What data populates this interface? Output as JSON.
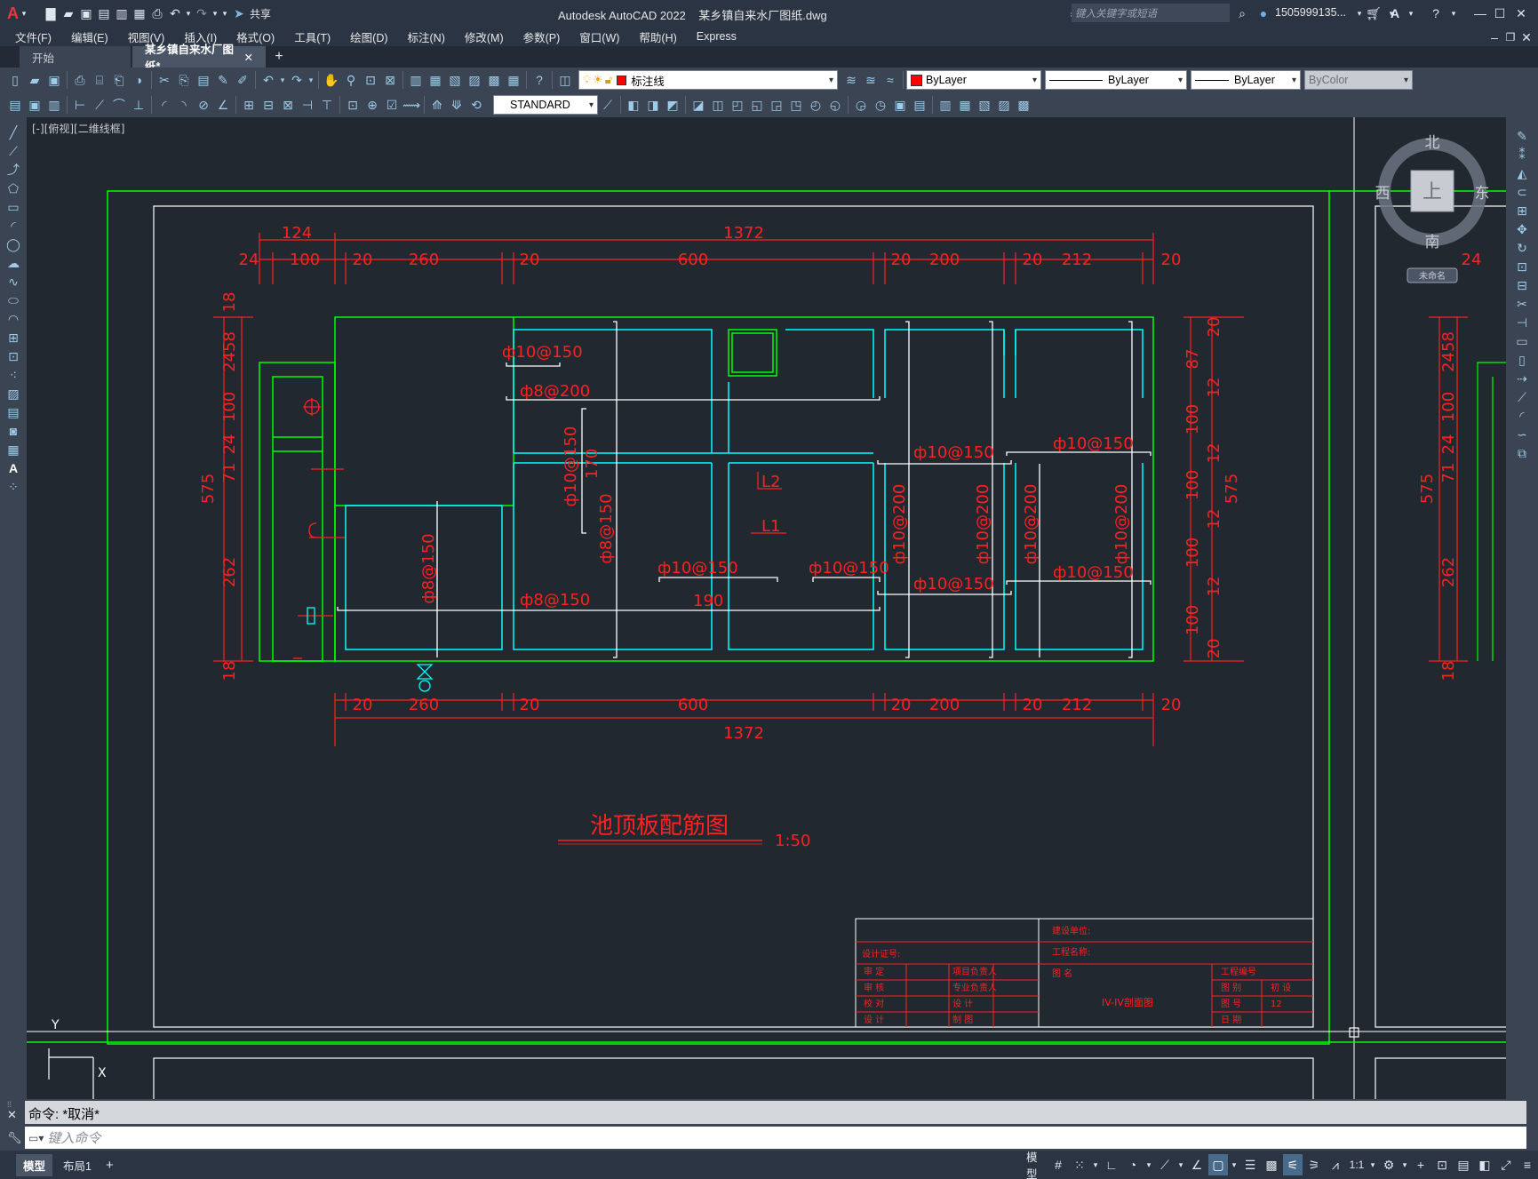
{
  "title": {
    "app_title": "Autodesk AutoCAD 2022",
    "file_title": "某乡镇自来水厂图纸.dwg",
    "share_label": "共享",
    "search_placeholder": "键入关键字或短语",
    "user_name": "1505999135..."
  },
  "menus": [
    "文件(F)",
    "编辑(E)",
    "视图(V)",
    "插入(I)",
    "格式(O)",
    "工具(T)",
    "绘图(D)",
    "标注(N)",
    "修改(M)",
    "参数(P)",
    "窗口(W)",
    "帮助(H)",
    "Express"
  ],
  "tabs": {
    "start": "开始",
    "drawing": "某乡镇自来水厂图纸*"
  },
  "toolbar": {
    "layer_name": "标注线",
    "color": "ByLayer",
    "linetype": "ByLayer",
    "lineweight": "ByLayer",
    "plotstyle": "ByColor",
    "dimstyle": "STANDARD"
  },
  "viewport_label": "[-][俯视][二维线框]",
  "viewcube": {
    "top": "上",
    "north": "北",
    "south": "南",
    "west": "西",
    "east": "东",
    "wcs": "未命名"
  },
  "drawing": {
    "title": "池顶板配筋图",
    "scale": "1:50",
    "top_dims_row1": [
      "124",
      "1372"
    ],
    "top_dims_row2": [
      "24",
      "100",
      "20",
      "260",
      "20",
      "600",
      "20",
      "200",
      "20",
      "212",
      "20"
    ],
    "bottom_dims": [
      "20",
      "260",
      "20",
      "600",
      "20",
      "200",
      "20",
      "212",
      "20"
    ],
    "bottom_total": "1372",
    "left_dims": [
      "18",
      "2458",
      "100",
      "24",
      "71",
      "262",
      "18"
    ],
    "left_total": "575",
    "right_dims": [
      "20",
      "87",
      "12",
      "100",
      "12",
      "100",
      "12",
      "100",
      "12",
      "100",
      "20"
    ],
    "right_total": "575",
    "rebar": {
      "r1": "ф10@150",
      "r2": "ф8@200",
      "r3": "ф10@150",
      "r4": "170",
      "r5": "ф8@150",
      "r6": "ф8@150",
      "r7": "ф8@150",
      "r8": "ф10@150",
      "r9": "190",
      "r10": "ф10@150",
      "r11": "ф10@150",
      "r12": "ф10@150",
      "r13": "ф10@150",
      "r14": "ф10@200",
      "r15": "ф10@200",
      "r16": "ф10@200",
      "r17": "ф10@200",
      "r18": "ф10@150",
      "l1": "L1",
      "l2": "L2"
    },
    "right_partial_dims": [
      "24",
      "2458",
      "100",
      "24",
      "71",
      "575",
      "262",
      "18"
    ]
  },
  "titleblock": {
    "build_unit": "建设单位:",
    "project_name": "工程名称:",
    "design_cert": "设计证号:",
    "drawing_name_label": "图  名",
    "drawing_name": "IV-IV剖面图",
    "rows_left": [
      "审  定",
      "审  核",
      "校  对",
      "设  计"
    ],
    "rows_mid": [
      "项目负责人",
      "专业负责人",
      "设  计",
      "制  图"
    ],
    "rows_right_label": [
      "工程编号",
      "图  别",
      "图  号",
      "日  期"
    ],
    "rows_right_value": [
      "",
      "初  设",
      "12",
      ""
    ]
  },
  "command": {
    "history": "命令: *取消*",
    "placeholder": "键入命令"
  },
  "layout_tabs": [
    "模型",
    "布局1"
  ],
  "status": {
    "model": "模型",
    "scale": "1:1"
  },
  "colors": {
    "green": "#00ff00",
    "cyan": "#00ffff",
    "red": "#ff2020",
    "white": "#ffffff",
    "accent": "#4a6a8a"
  }
}
